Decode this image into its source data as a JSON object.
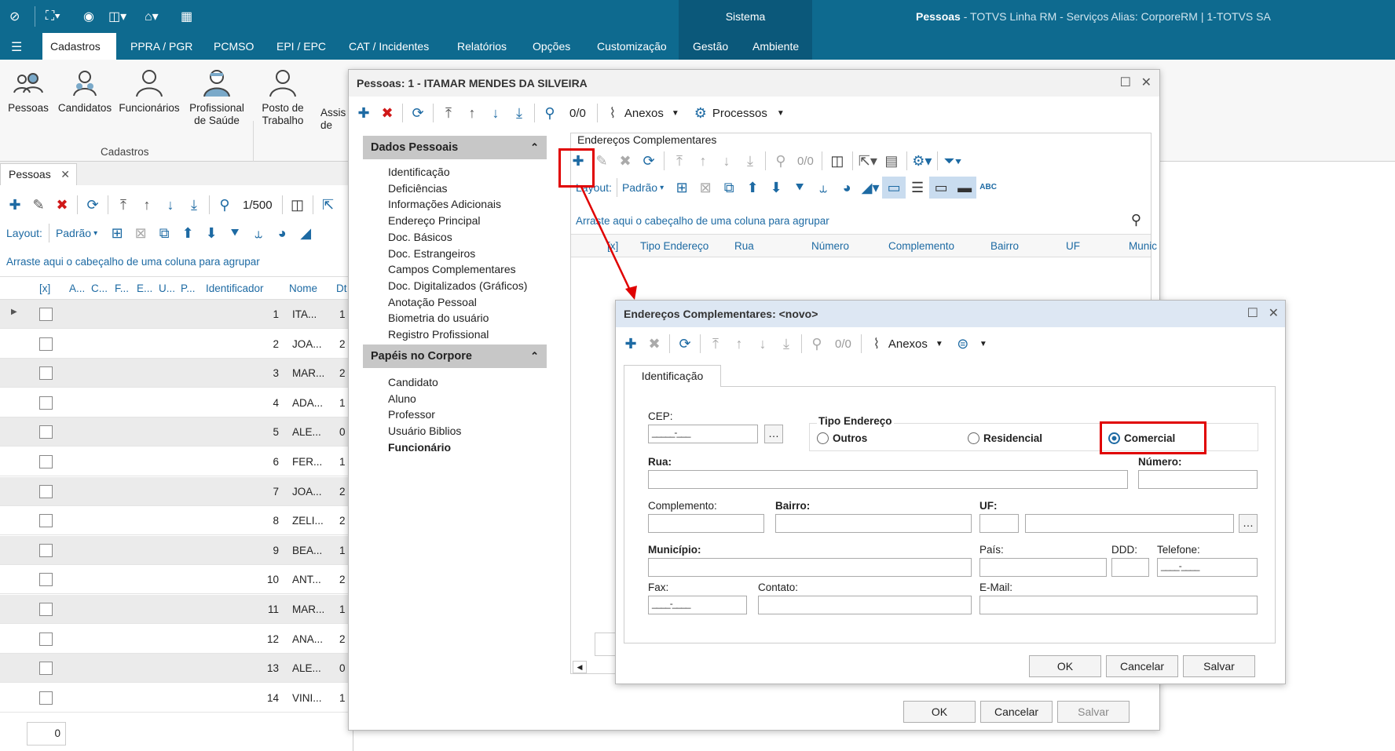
{
  "topbar": {
    "system": "Sistema",
    "title_main": "Pessoas",
    "title_rest": " - TOTVS Linha RM - Serviços  Alias: CorporeRM | 1-TOTVS SA"
  },
  "menu": {
    "items": [
      "Cadastros",
      "PPRA / PGR",
      "PCMSO",
      "EPI / EPC",
      "CAT / Incidentes",
      "Relatórios",
      "Opções",
      "Customização",
      "Gestão",
      "Ambiente"
    ]
  },
  "ribbon": {
    "buttons": [
      {
        "l1": "Pessoas",
        "l2": ""
      },
      {
        "l1": "Candidatos",
        "l2": ""
      },
      {
        "l1": "Funcionários",
        "l2": ""
      },
      {
        "l1": "Profissional",
        "l2": "de Saúde"
      },
      {
        "l1": "Posto de",
        "l2": "Trabalho"
      },
      {
        "l1": "Assis",
        "l2": "de"
      }
    ],
    "group": "Cadastros"
  },
  "left": {
    "tab": "Pessoas",
    "record": "1/500",
    "layout_label": "Layout:",
    "layout_value": "Padrão",
    "group_hint": "Arraste aqui o cabeçalho de uma coluna para agrupar",
    "columns": [
      "[x]",
      "A...",
      "C...",
      "F...",
      "E...",
      "U...",
      "P...",
      "Identificador",
      "Nome",
      "Dt"
    ],
    "rows": [
      {
        "id": "1",
        "nome": "ITA...",
        "dt": "1"
      },
      {
        "id": "2",
        "nome": "JOA...",
        "dt": "2"
      },
      {
        "id": "3",
        "nome": "MAR...",
        "dt": "2"
      },
      {
        "id": "4",
        "nome": "ADA...",
        "dt": "1"
      },
      {
        "id": "5",
        "nome": "ALE...",
        "dt": "0"
      },
      {
        "id": "6",
        "nome": "FER...",
        "dt": "1"
      },
      {
        "id": "7",
        "nome": "JOA...",
        "dt": "2"
      },
      {
        "id": "8",
        "nome": "ZELI...",
        "dt": "2"
      },
      {
        "id": "9",
        "nome": "BEA...",
        "dt": "1"
      },
      {
        "id": "10",
        "nome": "ANT...",
        "dt": "2"
      },
      {
        "id": "11",
        "nome": "MAR...",
        "dt": "1"
      },
      {
        "id": "12",
        "nome": "ANA...",
        "dt": "2"
      },
      {
        "id": "13",
        "nome": "ALE...",
        "dt": "0"
      },
      {
        "id": "14",
        "nome": "VINI...",
        "dt": "1"
      }
    ],
    "footer_count": "0"
  },
  "person_win": {
    "title": "Pessoas: 1 - ITAMAR MENDES DA SILVEIRA",
    "record": "0/0",
    "anexos": "Anexos",
    "processos": "Processos",
    "sec1": {
      "title": "Dados Pessoais",
      "items": [
        "Identificação",
        "Deficiências",
        "Informações Adicionais",
        "Endereço Principal",
        "Doc. Básicos",
        "Doc. Estrangeiros",
        "Campos Complementares",
        "Doc. Digitalizados (Gráficos)",
        "Anotação Pessoal",
        "Biometria do usuário",
        "Registro Profissional"
      ]
    },
    "sec2": {
      "title": "Papéis no Corpore",
      "items": [
        "Candidato",
        "Aluno",
        "Professor",
        "Usuário Biblios",
        "Funcionário"
      ]
    },
    "panel_title": "Endereços Complementares",
    "layout_label": "Layout:",
    "layout_value": "Padrão",
    "group_hint": "Arraste aqui o cabeçalho de uma coluna para agrupar",
    "columns": [
      "[x]",
      "Tipo Endereço",
      "Rua",
      "Número",
      "Complemento",
      "Bairro",
      "UF",
      "Munic"
    ],
    "ok": "OK",
    "cancel": "Cancelar",
    "save": "Salvar"
  },
  "addr_win": {
    "title": "Endereços Complementares: <novo>",
    "record": "0/0",
    "anexos": "Anexos",
    "tab": "Identificação",
    "cep_label": "CEP:",
    "cep_mask": "_____-___",
    "tipo_label": "Tipo Endereço",
    "opt1": "Outros",
    "opt2": "Residencial",
    "opt3": "Comercial",
    "rua": "Rua:",
    "numero": "Número:",
    "complemento": "Complemento:",
    "bairro": "Bairro:",
    "uf": "UF:",
    "municipio": "Município:",
    "pais": "País:",
    "ddd": "DDD:",
    "telefone": "Telefone:",
    "tel_mask": "____-____",
    "fax": "Fax:",
    "fax_mask": "____-____",
    "contato": "Contato:",
    "email": "E-Mail:",
    "ok": "OK",
    "cancel": "Cancelar",
    "save": "Salvar"
  },
  "colors": {
    "brand": "#0e6a8f",
    "accent": "#1d6aa3",
    "highlight": "#e00000"
  }
}
